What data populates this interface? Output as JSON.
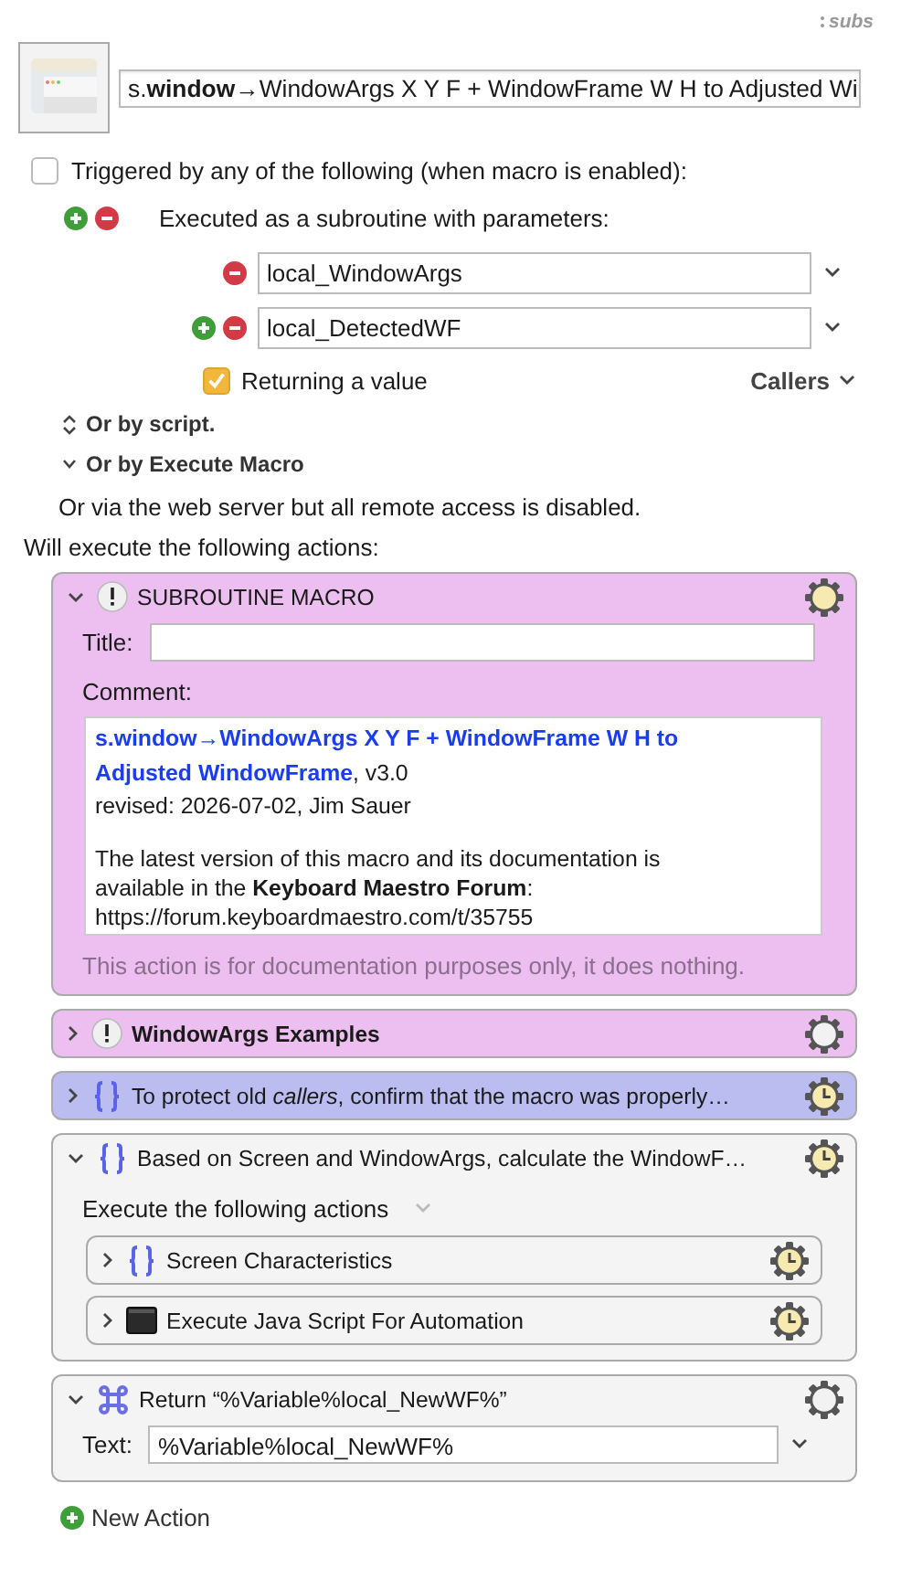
{
  "header": {
    "badge": "subs",
    "macro_name": "s.**window**→WindowArgs X Y F + WindowFrame W H to Adjusted Wi"
  },
  "trigger": {
    "label": "Triggered by any of the following (when macro is enabled):",
    "checked": false
  },
  "subroutine": {
    "label": "Executed as a subroutine with parameters:",
    "parameters": [
      {
        "value": "local_WindowArgs",
        "add_button": false
      },
      {
        "value": "local_DetectedWF",
        "add_button": true
      }
    ],
    "returning": {
      "label": "Returning a value",
      "checked": true
    },
    "callers": "Callers"
  },
  "options": [
    {
      "label": "Or by script.",
      "kind": "stepper"
    },
    {
      "label": "Or by Execute Macro",
      "kind": "disclosure"
    }
  ],
  "web_server_note": "Or via the web server but all remote access is disabled.",
  "actions_heading": "Will execute the following actions:",
  "actions": [
    {
      "kind": "comment",
      "title": "SUBROUTINE MACRO",
      "emphasized": false,
      "color": "#ecbff0",
      "expanded": true,
      "lit": true,
      "timed": false,
      "body": {
        "title_label": "Title:",
        "comment_label": "Comment:",
        "comment": [
          [
            "**s.window→WindowArgs X Y F + WindowFrame W H to Adjusted WindowFrame**, v3.0",
            "revised: 2026-07-02, Jim Sauer"
          ],
          [
            "The latest version of this macro and its documentation is available in the **Keyboard Maestro Forum**:",
            "https://forum.keyboardmaestro.com/t/35755"
          ]
        ],
        "note": "This action is for documentation purposes only, it does nothing."
      }
    },
    {
      "kind": "comment",
      "title": "WindowArgs Examples",
      "emphasized": true,
      "color": "#ecbff0",
      "expanded": false,
      "lit": false,
      "timed": false
    },
    {
      "kind": "group",
      "title": "To protect old *callers*, confirm that the macro was properly…",
      "emphasized": false,
      "color": "#bbbcef",
      "expanded": false,
      "lit": true,
      "timed": true
    },
    {
      "kind": "group",
      "title": "Based on Screen and WindowArgs, calculate the WindowF…",
      "emphasized": false,
      "color": "#f4f4f4",
      "expanded": true,
      "lit": true,
      "timed": true,
      "body": {
        "label": "Execute the following actions",
        "actions": [
          {
            "kind": "group",
            "title": "Screen Characteristics",
            "emphasized": false,
            "color": "#f4f4f4",
            "expanded": false,
            "lit": true,
            "timed": true
          },
          {
            "kind": "script",
            "title": "Execute Java Script For Automation",
            "emphasized": false,
            "color": "#f4f4f4",
            "expanded": false,
            "lit": true,
            "timed": true
          }
        ]
      }
    },
    {
      "kind": "return",
      "title": "Return “%Variable%local_NewWF%”",
      "emphasized": false,
      "color": "#f4f4f4",
      "expanded": true,
      "lit": false,
      "timed": false,
      "body": {
        "text_label": "Text:",
        "text_value": "%Variable%local_NewWF%"
      }
    }
  ],
  "new_action": "New Action"
}
